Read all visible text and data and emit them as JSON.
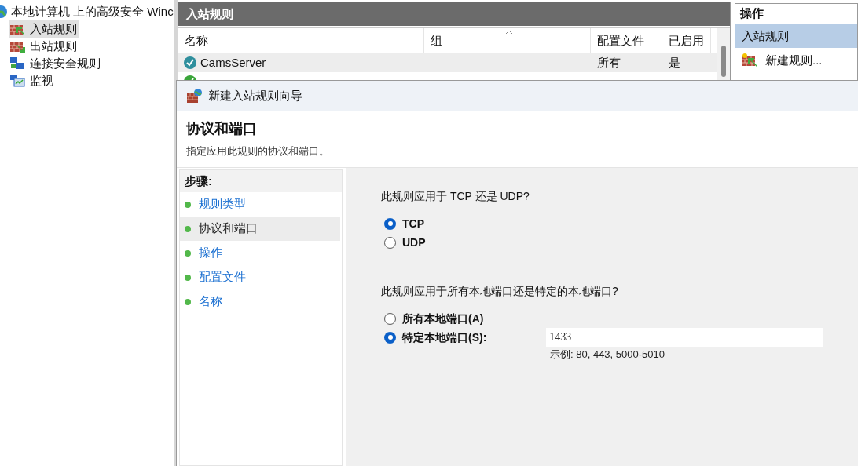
{
  "tree": {
    "root": {
      "label": "本地计算机 上的高级安全 Winc"
    },
    "items": [
      {
        "label": "入站规则",
        "kind": "inbound",
        "selected": true
      },
      {
        "label": "出站规则",
        "kind": "outbound",
        "selected": false
      },
      {
        "label": "连接安全规则",
        "kind": "connection",
        "selected": false
      },
      {
        "label": "监视",
        "kind": "monitor",
        "selected": false
      }
    ]
  },
  "rules_panel": {
    "title": "入站规则",
    "columns": [
      "名称",
      "组",
      "配置文件",
      "已启用"
    ],
    "rows": [
      {
        "cells": [
          "CamsServer",
          "",
          "所有",
          "是"
        ],
        "color": "#2f8f9d"
      },
      {
        "color": "#3aa53a"
      }
    ]
  },
  "actions": {
    "title": "操作",
    "items": [
      {
        "label": "入站规则",
        "kind": "header",
        "selected": true
      },
      {
        "label": "新建规则...",
        "kind": "new_rule",
        "selected": false
      }
    ]
  },
  "wizard": {
    "title": "新建入站规则向导",
    "heading": "协议和端口",
    "description": "指定应用此规则的协议和端口。",
    "steps_title": "步骤:",
    "steps": [
      {
        "label": "规则类型",
        "selected": false
      },
      {
        "label": "协议和端口",
        "selected": true
      },
      {
        "label": "操作",
        "selected": false
      },
      {
        "label": "配置文件",
        "selected": false
      },
      {
        "label": "名称",
        "selected": false
      }
    ],
    "protocol": {
      "question": "此规则应用于 TCP 还是 UDP?",
      "options": [
        {
          "label": "TCP",
          "selected": true
        },
        {
          "label": "UDP",
          "selected": false
        }
      ]
    },
    "ports": {
      "question": "此规则应用于所有本地端口还是特定的本地端口?",
      "options": [
        {
          "label": "所有本地端口(A)",
          "selected": false
        },
        {
          "label": "特定本地端口(S):",
          "selected": true
        }
      ],
      "value": "1433",
      "example": "示例: 80, 443, 5000-5010"
    }
  }
}
